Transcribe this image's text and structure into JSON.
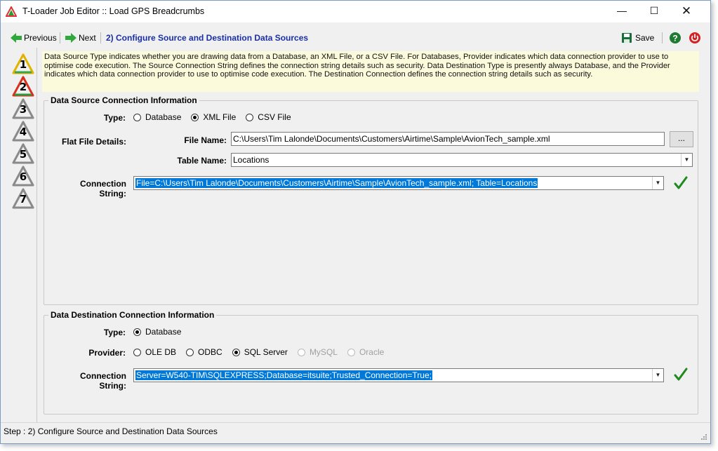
{
  "window": {
    "title": "T-Loader Job Editor :: Load GPS Breadcrumbs",
    "minimize": "—",
    "maximize": "☐",
    "close": "✕"
  },
  "toolbar": {
    "previous_label": "Previous",
    "next_label": "Next",
    "step_title": "2) Configure Source and Destination Data Sources",
    "save_label": "Save"
  },
  "steps": [
    {
      "num": "1",
      "state": "done"
    },
    {
      "num": "2",
      "state": "current"
    },
    {
      "num": "3",
      "state": "pending"
    },
    {
      "num": "4",
      "state": "pending"
    },
    {
      "num": "5",
      "state": "pending"
    },
    {
      "num": "6",
      "state": "pending"
    },
    {
      "num": "7",
      "state": "pending"
    }
  ],
  "info_text": "Data Source Type indicates whether you are drawing data from a Database, an XML File, or a CSV File. For Databases, Provider indicates which data  connection provider to use to optimise code execution. The Source Connection String defines the connection string details such as security. Data Destination Type is presently always Database, and the Provider indicates which data connection provider to use to optimise code execution. The Destination Connection defines the connection string details such as security.",
  "source": {
    "legend": "Data Source Connection Information",
    "type_label": "Type:",
    "type_options": [
      {
        "label": "Database",
        "selected": false
      },
      {
        "label": "XML File",
        "selected": true
      },
      {
        "label": "CSV File",
        "selected": false
      }
    ],
    "flat_file_label": "Flat File Details:",
    "file_name_label": "File Name:",
    "file_name_value": "C:\\Users\\Tim Lalonde\\Documents\\Customers\\Airtime\\Sample\\AvionTech_sample.xml",
    "browse_label": "...",
    "table_name_label": "Table Name:",
    "table_name_value": "Locations",
    "conn_label": "Connection String:",
    "conn_value": "File=C:\\Users\\Tim Lalonde\\Documents\\Customers\\Airtime\\Sample\\AvionTech_sample.xml; Table=Locations"
  },
  "destination": {
    "legend": "Data Destination Connection Information",
    "type_label": "Type:",
    "type_options": [
      {
        "label": "Database",
        "selected": true
      }
    ],
    "provider_label": "Provider:",
    "provider_options": [
      {
        "label": "OLE DB",
        "selected": false,
        "disabled": false
      },
      {
        "label": "ODBC",
        "selected": false,
        "disabled": false
      },
      {
        "label": "SQL Server",
        "selected": true,
        "disabled": false
      },
      {
        "label": "MySQL",
        "selected": false,
        "disabled": true
      },
      {
        "label": "Oracle",
        "selected": false,
        "disabled": true
      }
    ],
    "conn_label": "Connection String:",
    "conn_value": "Server=W540-TIM\\SQLEXPRESS;Database=itsuite;Trusted_Connection=True;"
  },
  "status": {
    "text": "Step : 2) Configure Source and Destination Data Sources"
  },
  "colors": {
    "accent": "#1a2ea6",
    "selection": "#0078d7",
    "check": "#1f8a1f",
    "info_bg": "#fbfbdc"
  }
}
